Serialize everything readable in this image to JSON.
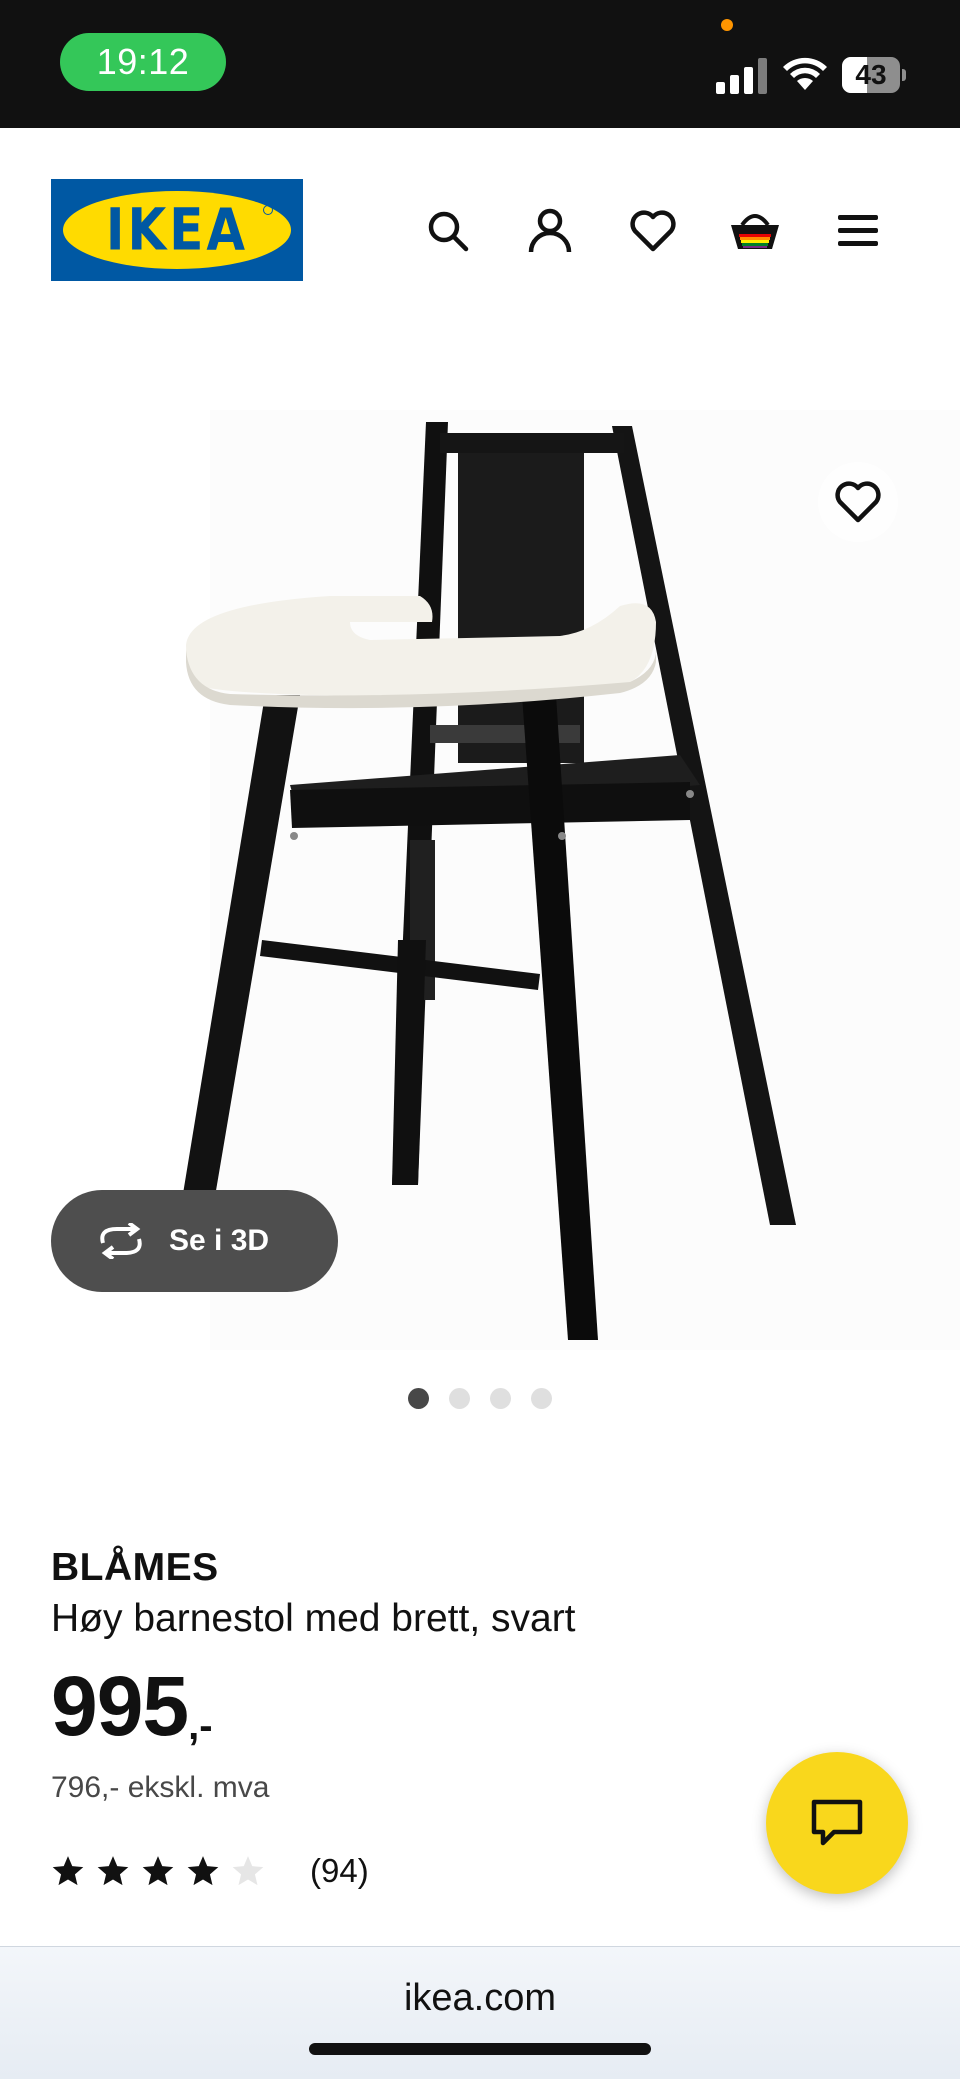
{
  "status_bar": {
    "time": "19:12",
    "battery": "43",
    "battery_level": 0.43
  },
  "header": {
    "logo_text": "IKEA",
    "icons": [
      "search-icon",
      "account-icon",
      "heart-icon",
      "basket-icon",
      "menu-icon"
    ]
  },
  "gallery": {
    "view_3d_label": "Se i 3D",
    "image_count": 4,
    "active_index": 0
  },
  "product": {
    "name": "BLÅMES",
    "description": "Høy barnestol med brett, svart",
    "price_integer": "995",
    "price_suffix": ",-",
    "price_ex_vat": "796,- ekskl. mva",
    "rating": 4,
    "rating_max": 5,
    "review_count": "(94)"
  },
  "browser": {
    "url": "ikea.com"
  },
  "colors": {
    "ikea_blue": "#0058a3",
    "ikea_yellow": "#ffdb00",
    "chat_yellow": "#f9d71c",
    "status_green": "#34c759"
  }
}
